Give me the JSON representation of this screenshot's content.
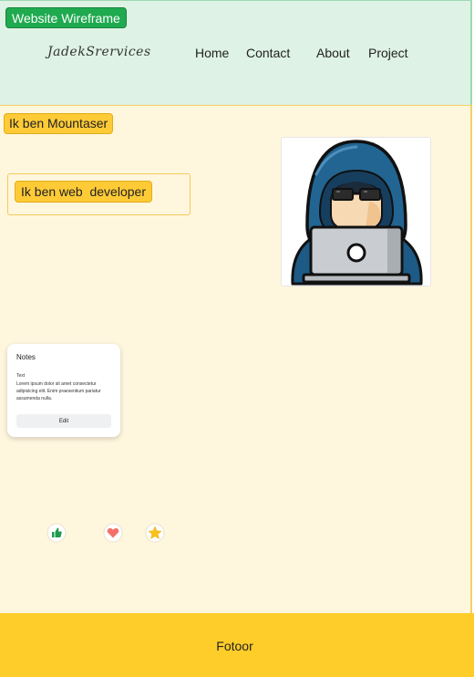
{
  "header": {
    "frame_tag": "Website Wireframe",
    "brand": "JadekSrervices",
    "nav": {
      "home": "Home",
      "contact": "Contact",
      "about": "About",
      "project": "Project"
    }
  },
  "main": {
    "frame_label": "Ik ben Mountaser",
    "intro_label": "Ik ben web  developer",
    "avatar_icon": "hacker-with-laptop-icon",
    "notes": {
      "title": "Notes",
      "body_label": "Text",
      "body": "Lorem ipsum dolor sit amet consectetur adipisicing elit. Enim praesentium pariatur assumenda nulla.",
      "edit_label": "Edit"
    },
    "reactions": [
      "thumbs-up-icon",
      "heart-icon",
      "star-icon"
    ]
  },
  "footer": {
    "text": "Fotoor"
  },
  "colors": {
    "header_bg": "#def2e5",
    "main_bg": "#fff6de",
    "footer_bg": "#ffcd29",
    "accent_green": "#1faa4f",
    "accent_yellow": "#fecb37"
  }
}
